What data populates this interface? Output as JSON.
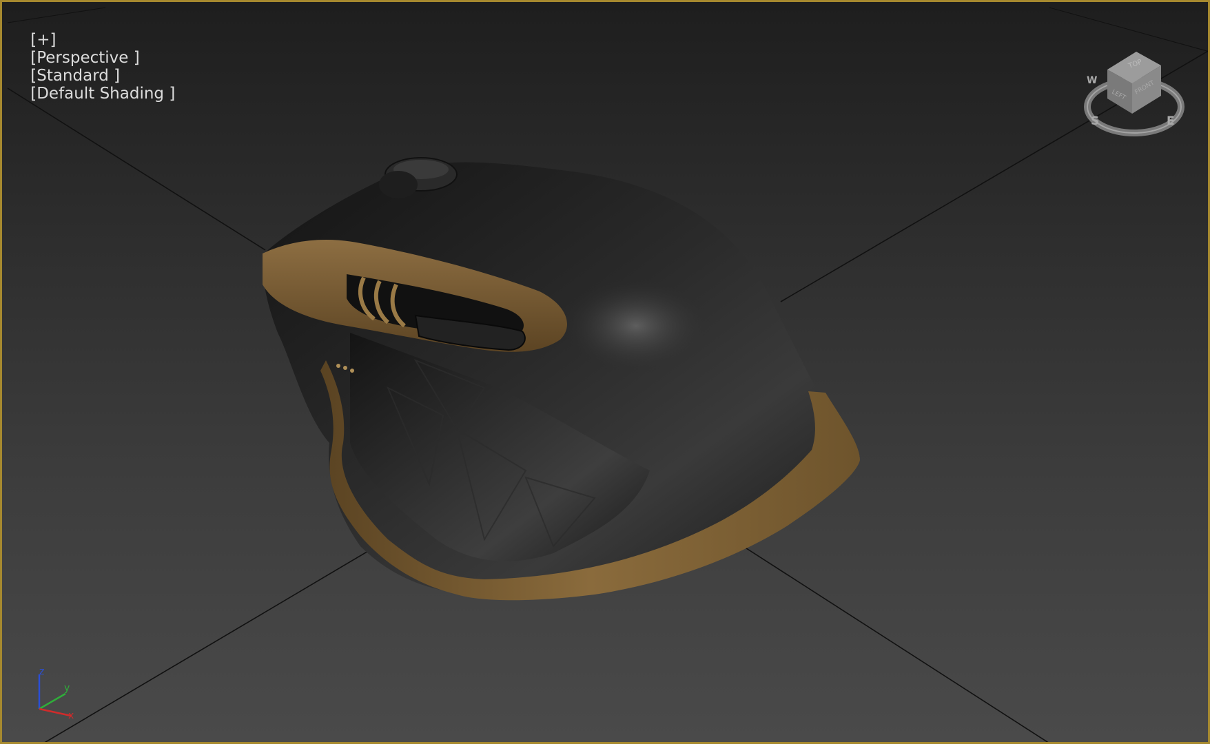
{
  "viewport": {
    "labels": {
      "plus": "[+]",
      "view": "[Perspective ]",
      "mode": "[Standard ]",
      "shading": "[Default Shading ]"
    },
    "active_border_color": "#a6892f",
    "model_colors": {
      "body": "#1c1c1c",
      "accent": "#7e6134"
    }
  },
  "viewcube": {
    "top": "TOP",
    "front": "FRONT",
    "left": "LEFT",
    "compass": {
      "s": "S",
      "e": "E",
      "w": "W"
    }
  },
  "axis_tripod": {
    "x": "x",
    "y": "y",
    "z": "z"
  }
}
